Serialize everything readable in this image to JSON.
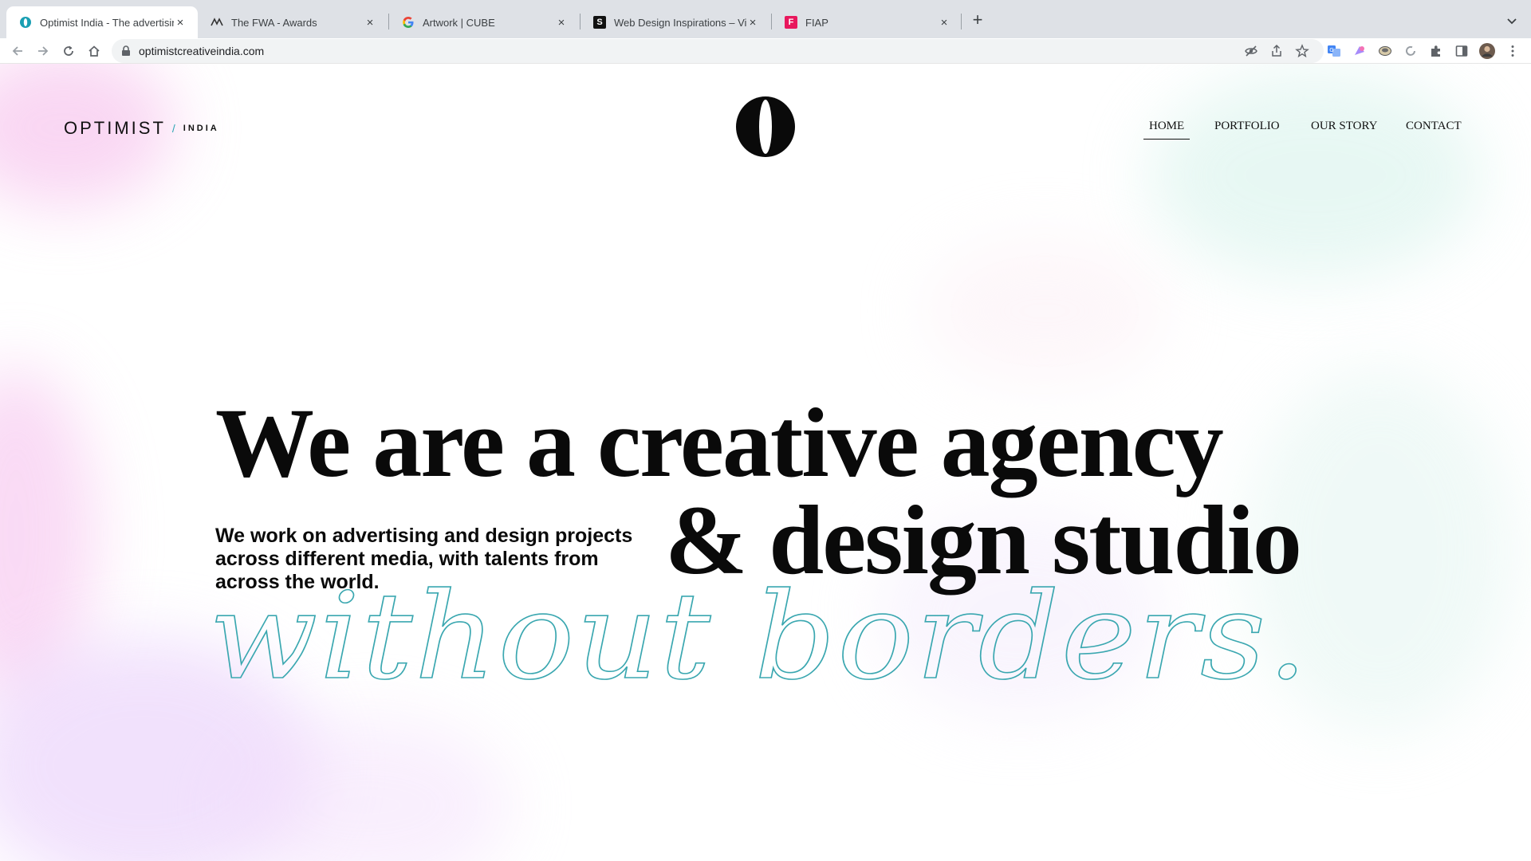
{
  "browser": {
    "tabs": [
      {
        "title": "Optimist India - The advertising",
        "favicon": "optimist-favicon",
        "active": true
      },
      {
        "title": "The FWA - Awards",
        "favicon": "fwa-favicon",
        "active": false
      },
      {
        "title": "Artwork | CUBE",
        "favicon": "google-favicon",
        "active": false
      },
      {
        "title": "Web Design Inspirations – Vict",
        "favicon": "s-favicon",
        "active": false
      },
      {
        "title": "FIAP",
        "favicon": "fiap-favicon",
        "active": false
      }
    ],
    "url": "optimistcreativeindia.com"
  },
  "site": {
    "logo": {
      "main": "OPTIMIST",
      "slash": "/",
      "sub": "INDIA"
    },
    "center_mark": "O",
    "nav": [
      {
        "label": "HOME",
        "active": true
      },
      {
        "label": "PORTFOLIO",
        "active": false
      },
      {
        "label": "OUR STORY",
        "active": false
      },
      {
        "label": "CONTACT",
        "active": false
      }
    ],
    "hero": {
      "line1": "We are a creative agency",
      "line2": "& design studio",
      "script": "without borders.",
      "subtitle": "We work on advertising and design projects across different media, with talents from across the world."
    }
  },
  "colors": {
    "accent": "#3aa7b0",
    "text": "#0a0a0a",
    "tabstrip": "#dee1e6"
  }
}
